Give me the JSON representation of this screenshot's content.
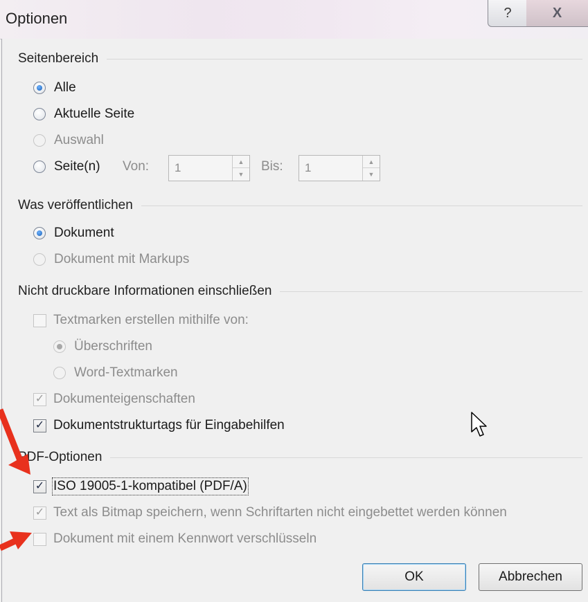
{
  "window": {
    "title": "Optionen",
    "help_glyph": "?",
    "close_glyph": "X"
  },
  "page_range": {
    "heading": "Seitenbereich",
    "options": [
      {
        "label": "Alle",
        "checked": true,
        "enabled": true
      },
      {
        "label": "Aktuelle Seite",
        "checked": false,
        "enabled": true
      },
      {
        "label": "Auswahl",
        "checked": false,
        "enabled": false
      },
      {
        "label": "Seite(n)",
        "checked": false,
        "enabled": true
      }
    ],
    "from_label": "Von:",
    "from_value": "1",
    "to_label": "Bis:",
    "to_value": "1"
  },
  "publish": {
    "heading": "Was veröffentlichen",
    "options": [
      {
        "label": "Dokument",
        "checked": true,
        "enabled": true
      },
      {
        "label": "Dokument mit Markups",
        "checked": false,
        "enabled": false
      }
    ]
  },
  "nonprint": {
    "heading": "Nicht druckbare Informationen einschließen",
    "bookmarks_label": "Textmarken erstellen mithilfe von:",
    "bookmarks_checked": false,
    "bookmark_sources": [
      {
        "label": "Überschriften",
        "checked": true
      },
      {
        "label": "Word-Textmarken",
        "checked": false
      }
    ],
    "doc_props_label": "Dokumenteigenschaften",
    "doc_props_checked": true,
    "struct_tags_label": "Dokumentstrukturtags für Eingabehilfen",
    "struct_tags_checked": true
  },
  "pdf": {
    "heading": "PDF-Optionen",
    "iso_label": "ISO 19005-1-kompatibel (PDF/A)",
    "iso_checked": true,
    "bitmap_label": "Text als Bitmap speichern, wenn Schriftarten nicht eingebettet werden können",
    "bitmap_checked": true,
    "encrypt_label": "Dokument mit einem Kennwort verschlüsseln",
    "encrypt_checked": false
  },
  "buttons": {
    "ok": "OK",
    "cancel": "Abbrechen"
  },
  "colors": {
    "annotation_arrow": "#e8311d",
    "accent": "#1a5fb4"
  }
}
